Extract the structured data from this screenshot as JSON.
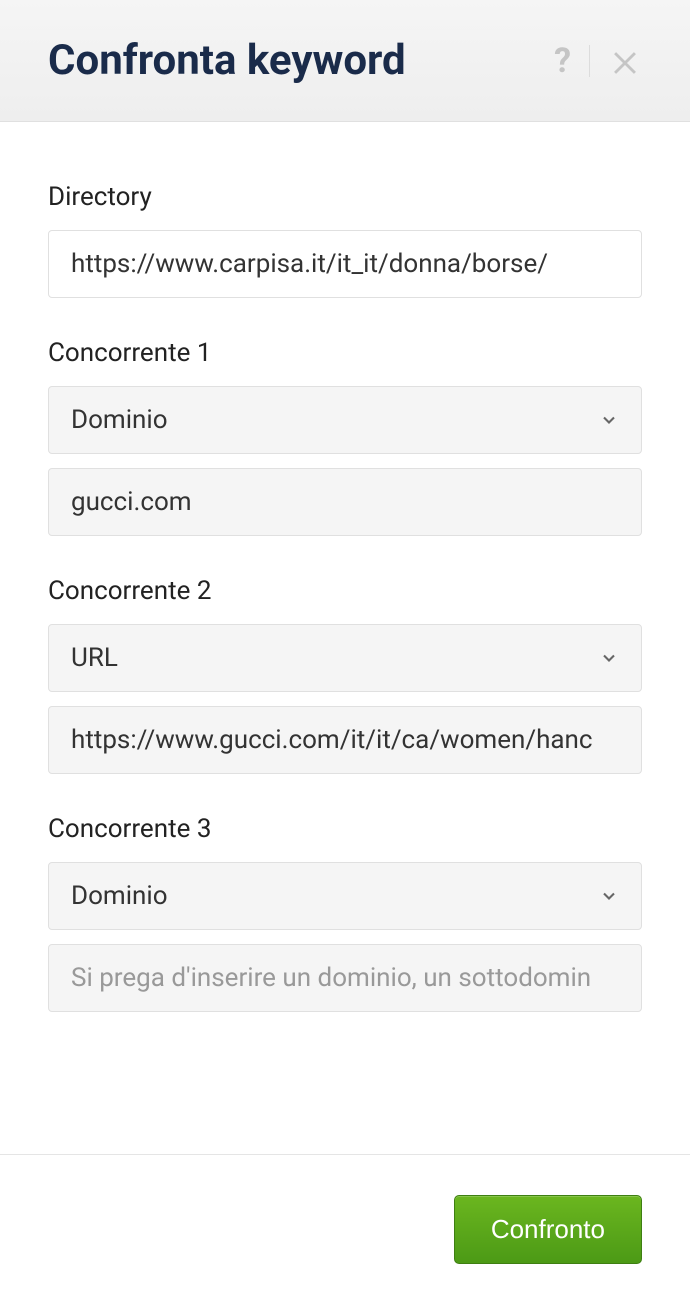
{
  "header": {
    "title": "Confronta keyword"
  },
  "directory": {
    "label": "Directory",
    "value": "https://www.carpisa.it/it_it/donna/borse/"
  },
  "competitors": [
    {
      "label": "Concorrente 1",
      "type_selected": "Dominio",
      "value": "gucci.com",
      "placeholder": ""
    },
    {
      "label": "Concorrente 2",
      "type_selected": "URL",
      "value": "https://www.gucci.com/it/it/ca/women/hanc",
      "placeholder": ""
    },
    {
      "label": "Concorrente 3",
      "type_selected": "Dominio",
      "value": "",
      "placeholder": "Si prega d'inserire un dominio, un sottodomin"
    }
  ],
  "footer": {
    "submit_label": "Confronto"
  }
}
